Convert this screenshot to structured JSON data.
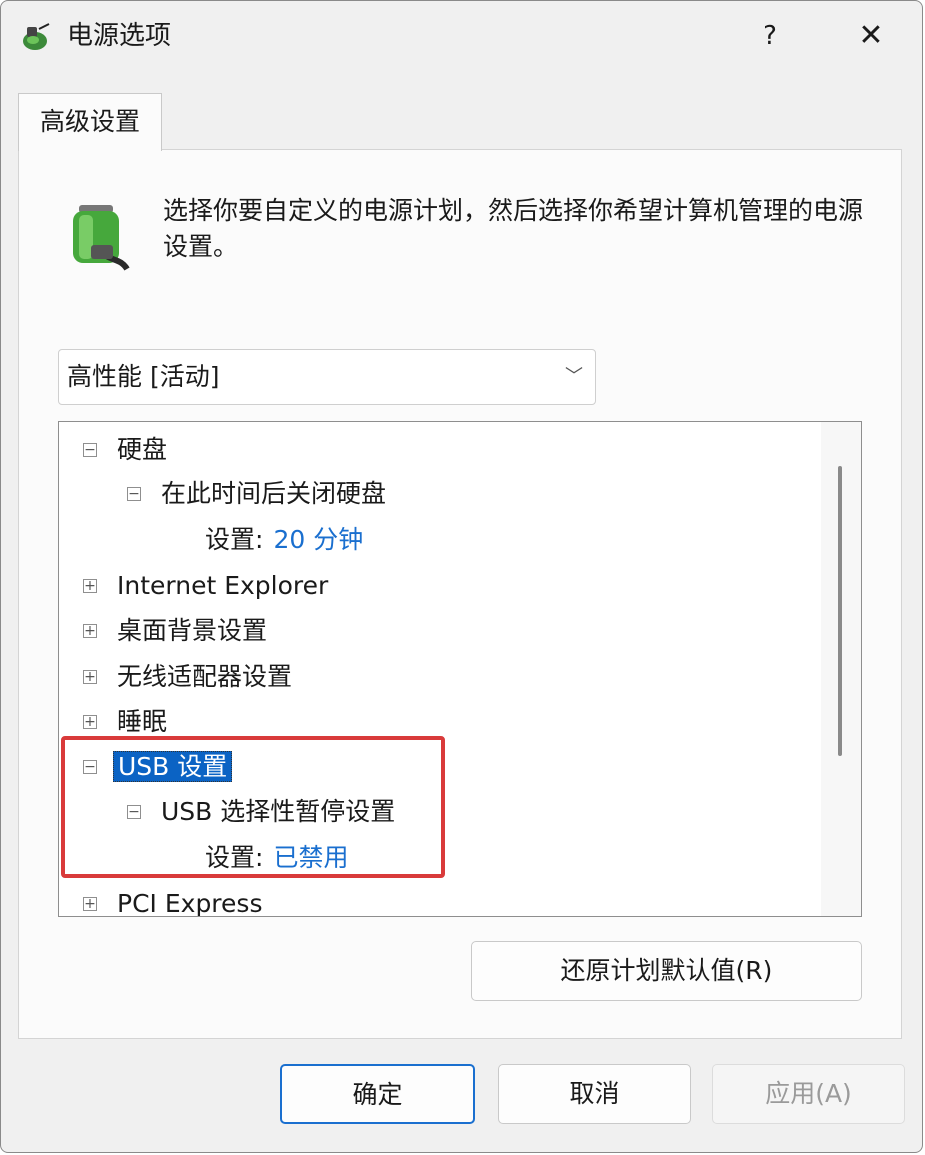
{
  "window": {
    "title": "电源选项",
    "help": "?",
    "close": "✕"
  },
  "tab": {
    "label": "高级设置"
  },
  "description": "选择你要自定义的电源计划，然后选择你希望计算机管理的电源设置。",
  "plan_select": {
    "value": "高性能 [活动]"
  },
  "tree": {
    "hard_disk": "硬盘",
    "turn_off_disk": "在此时间后关闭硬盘",
    "disk_setting_label": "设置:",
    "disk_setting_value": "20 分钟",
    "internet_explorer": "Internet Explorer",
    "desktop_background": "桌面背景设置",
    "wireless_adapter": "无线适配器设置",
    "sleep": "睡眠",
    "usb_settings": "USB 设置",
    "usb_selective_suspend": "USB 选择性暂停设置",
    "usb_setting_label": "设置:",
    "usb_setting_value": "已禁用",
    "pci_express": "PCI Express"
  },
  "buttons": {
    "restore": "还原计划默认值(R)",
    "ok": "确定",
    "cancel": "取消",
    "apply": "应用(A)"
  },
  "colors": {
    "link_value": "#1a6fcf",
    "selection": "#0b63c4",
    "highlight_box": "#d93a3a"
  }
}
